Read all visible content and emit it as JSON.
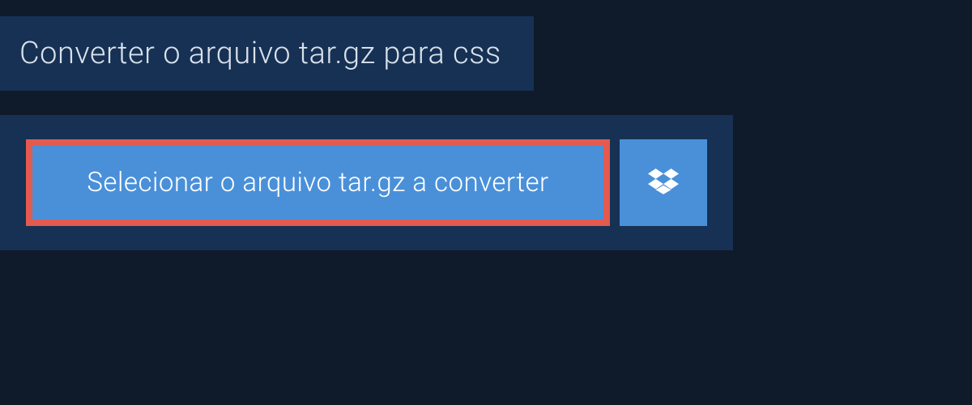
{
  "header": {
    "title": "Converter o arquivo tar.gz para css"
  },
  "actions": {
    "select_file_label": "Selecionar o arquivo tar.gz a converter"
  },
  "colors": {
    "background": "#0f1b2a",
    "panel": "#163154",
    "button": "#4a90d9",
    "highlight_border": "#e35a4f",
    "text_light": "#d8e1eb",
    "text_white": "#ffffff"
  }
}
